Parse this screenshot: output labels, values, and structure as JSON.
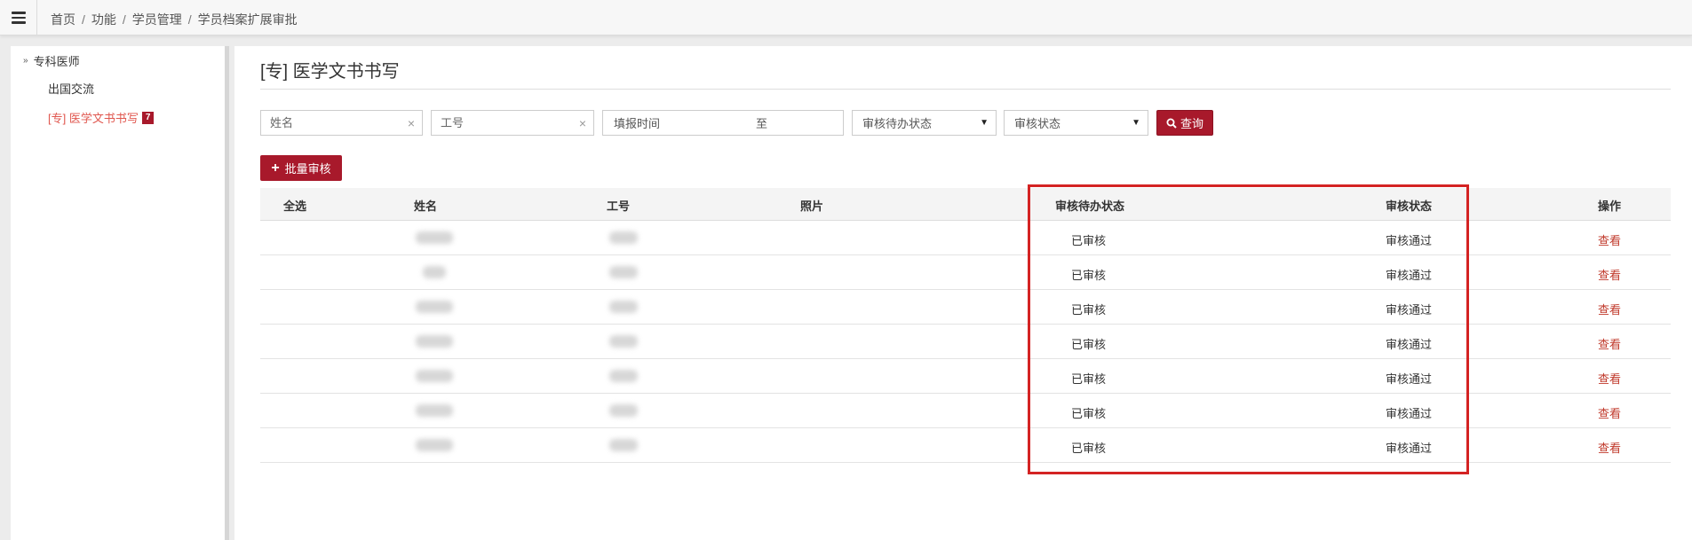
{
  "breadcrumb": [
    "首页",
    "功能",
    "学员管理",
    "学员档案扩展审批"
  ],
  "sidebar": {
    "root": "专科医师",
    "items": [
      {
        "label": "出国交流",
        "badge": ""
      },
      {
        "label": "[专] 医学文书书写",
        "badge": "7"
      }
    ]
  },
  "page": {
    "title": "[专] 医学文书书写"
  },
  "filters": {
    "name_placeholder": "姓名",
    "id_placeholder": "工号",
    "date_label": "填报时间",
    "date_to": "至",
    "pending_status": "审核待办状态",
    "audit_status": "审核状态",
    "query_label": "查询",
    "batch_label": "批量审核"
  },
  "table": {
    "headers": [
      "全选",
      "姓名",
      "工号",
      "照片",
      "审核待办状态",
      "审核状态",
      "操作"
    ],
    "rows": [
      {
        "pending": "已审核",
        "status": "审核通过",
        "action": "查看"
      },
      {
        "pending": "已审核",
        "status": "审核通过",
        "action": "查看"
      },
      {
        "pending": "已审核",
        "status": "审核通过",
        "action": "查看"
      },
      {
        "pending": "已审核",
        "status": "审核通过",
        "action": "查看"
      },
      {
        "pending": "已审核",
        "status": "审核通过",
        "action": "查看"
      },
      {
        "pending": "已审核",
        "status": "审核通过",
        "action": "查看"
      },
      {
        "pending": "已审核",
        "status": "审核通过",
        "action": "查看"
      }
    ]
  },
  "colors": {
    "accent": "#a8192b",
    "active_link": "#e0574f",
    "highlight": "#d42323"
  }
}
